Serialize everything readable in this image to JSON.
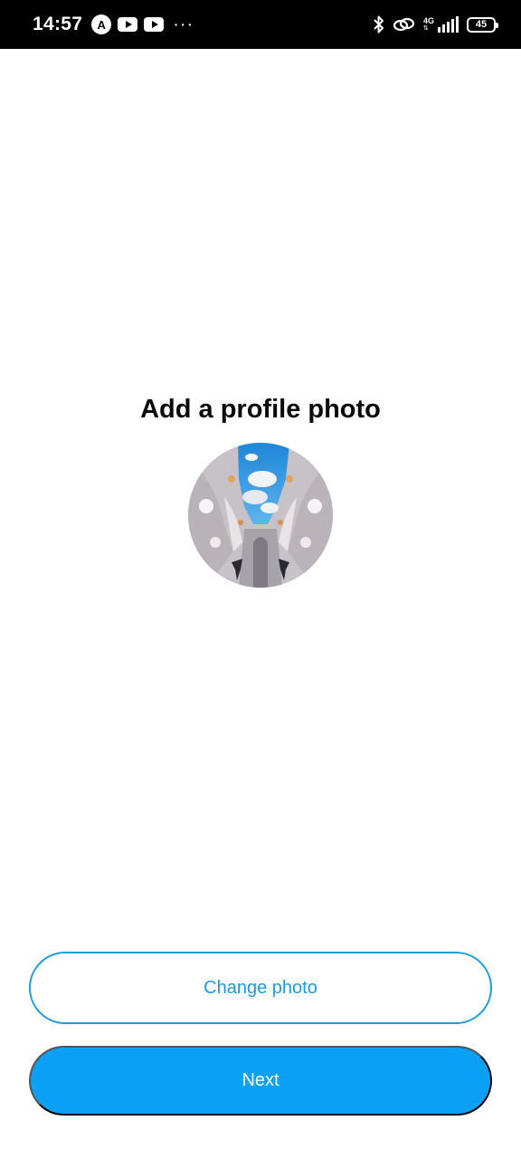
{
  "status_bar": {
    "time": "14:57",
    "app_icon_letter": "A",
    "more": "···",
    "network": "4G",
    "battery": "45"
  },
  "page": {
    "title": "Add a profile photo"
  },
  "buttons": {
    "change_photo": "Change photo",
    "next": "Next"
  },
  "colors": {
    "accent": "#0aa0f6",
    "outline": "#1e9ae0"
  }
}
